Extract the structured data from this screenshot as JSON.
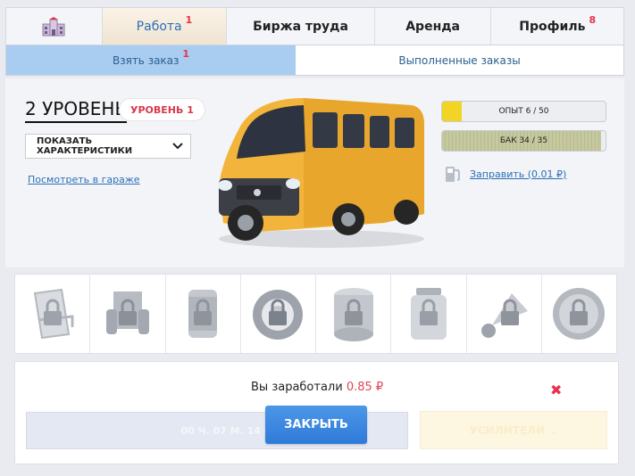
{
  "nav": {
    "home_icon": "city-building-icon",
    "tabs": [
      {
        "label": "Работа",
        "badge": "1"
      },
      {
        "label": "Биржа труда",
        "badge": ""
      },
      {
        "label": "Аренда",
        "badge": ""
      },
      {
        "label": "Профиль",
        "badge": "8"
      }
    ]
  },
  "subtabs": [
    {
      "label": "Взять заказ",
      "badge": "1"
    },
    {
      "label": "Выполненные заказы"
    }
  ],
  "vehicle": {
    "level_title": "2 УРОВЕНЬ",
    "level_pill": "УРОВЕНЬ 1",
    "show_chars": "ПОКАЗАТЬ ХАРАКТЕРИСТИКИ",
    "garage_link": "Посмотреть в гараже",
    "image": "yellow-minibus-van"
  },
  "stats": {
    "exp_label": "ОПЫТ 6 / 50",
    "exp_fraction": 0.12,
    "tank_label": "БАК 34 / 35",
    "tank_fraction": 0.97,
    "refuel_label": "Заправить (0.01 ₽)",
    "refuel_icon": "fuel-pump-icon"
  },
  "boosters": [
    {
      "name": "deck-chair-locked"
    },
    {
      "name": "armchair-locked"
    },
    {
      "name": "can-locked"
    },
    {
      "name": "tire-locked"
    },
    {
      "name": "money-roll-locked"
    },
    {
      "name": "jar-locked"
    },
    {
      "name": "horn-locked"
    },
    {
      "name": "coin-locked"
    }
  ],
  "result": {
    "earned_prefix": "Вы заработали",
    "earned_amount": "0.85 ₽",
    "close_button": "ЗАКРЫТЬ",
    "timer_text": "00 Ч. 07 М. 14 С.",
    "boosters_button": "УСИЛИТЕЛИ ⌄",
    "dismiss": "✖"
  },
  "colors": {
    "accent_blue": "#2e7ad8",
    "badge_red": "#e8314f",
    "exp_yellow": "#f3d324"
  }
}
